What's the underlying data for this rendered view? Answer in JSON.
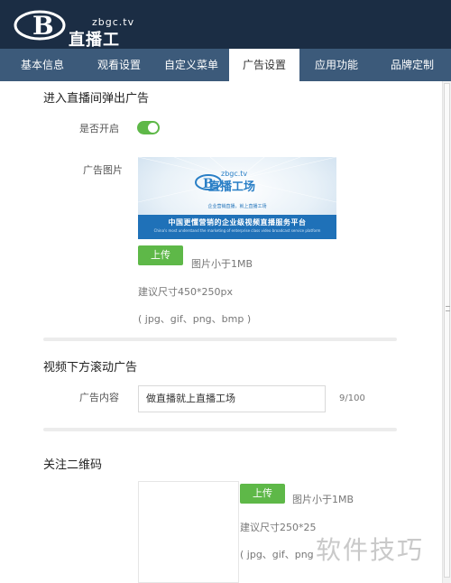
{
  "header": {
    "logo_domain": "zbgc.tv",
    "logo_name": "直播工场"
  },
  "tabs": [
    {
      "label": "基本信息",
      "active": false
    },
    {
      "label": "观看设置",
      "active": false
    },
    {
      "label": "自定义菜单",
      "active": false
    },
    {
      "label": "广告设置",
      "active": true
    },
    {
      "label": "应用功能",
      "active": false
    },
    {
      "label": "品牌定制",
      "active": false
    }
  ],
  "popup_ad": {
    "title": "进入直播间弹出广告",
    "enable_label": "是否开启",
    "enabled": true,
    "image_label": "广告图片",
    "image": {
      "logo_domain": "zbgc.tv",
      "logo_name": "直播工场",
      "tagline": "企业营销直播，就上直播工场",
      "banner_text": "中国更懂营销的企业级视频直播服务平台",
      "banner_subtext": "China's most understand the marketing of enterprise class video broadcast service platform"
    },
    "upload_label": "上传",
    "size_hint": "图片小于1MB",
    "dimension_hint": "建议尺寸450*250px",
    "format_hint": "( jpg、gif、png、bmp )"
  },
  "scroll_ad": {
    "title": "视频下方滚动广告",
    "content_label": "广告内容",
    "content_value": "做直播就上直播工场",
    "char_count": "9/100"
  },
  "qr_code": {
    "title": "关注二维码",
    "upload_label": "上传",
    "size_hint": "图片小于1MB",
    "dimension_hint": "建议尺寸250*25",
    "format_hint": "( jpg、gif、png"
  },
  "watermark": "软件技巧",
  "colors": {
    "header_bg": "#1b2d44",
    "tabs_bg": "#3c5a7a",
    "accent_green": "#5eb848",
    "banner_blue": "#1f71b8"
  }
}
